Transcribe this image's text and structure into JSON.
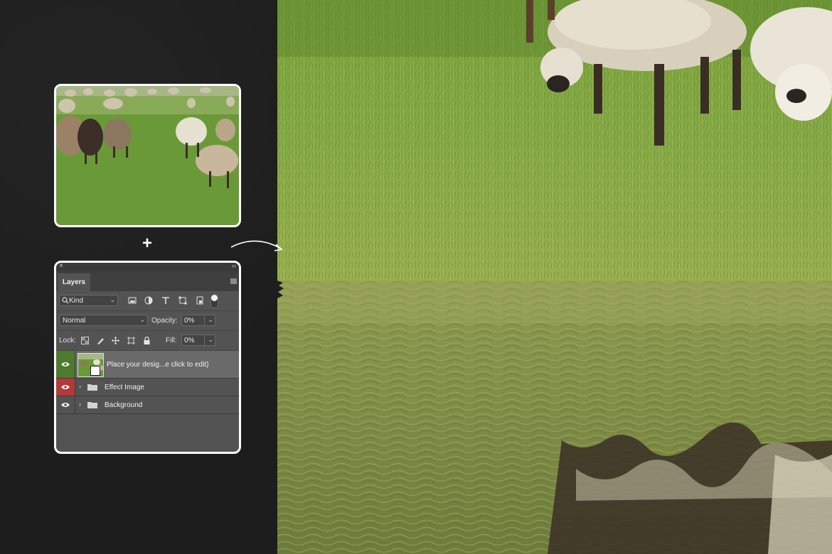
{
  "panel": {
    "close_glyph": "×",
    "collapse_glyph": "‹‹",
    "tab_label": "Layers",
    "filter": {
      "kind_label": "Kind",
      "icons": [
        "image-filter-icon",
        "adjustment-filter-icon",
        "type-filter-icon",
        "shape-filter-icon",
        "smart-object-filter-icon"
      ]
    },
    "blend_mode": "Normal",
    "opacity_label": "Opacity:",
    "opacity_value": "0%",
    "lock_label": "Lock:",
    "fill_label": "Fill:",
    "fill_value": "0%",
    "layers": [
      {
        "name": "Place your desig...e click to edit)",
        "type": "smart-object",
        "visible": true,
        "eye_color": "#4f7a2e",
        "selected": true
      },
      {
        "name": "Effect Image",
        "type": "group",
        "visible": true,
        "eye_color": "#b23a3a"
      },
      {
        "name": "Background",
        "type": "group",
        "visible": true
      }
    ]
  },
  "plus_glyph": "+",
  "colors": {
    "page_bg": "#1c1c1c",
    "panel_bg": "#535353",
    "selected_layer_bg": "#6a6a6a",
    "grass": "#6f9a3a",
    "water": "#7d8a4a"
  }
}
